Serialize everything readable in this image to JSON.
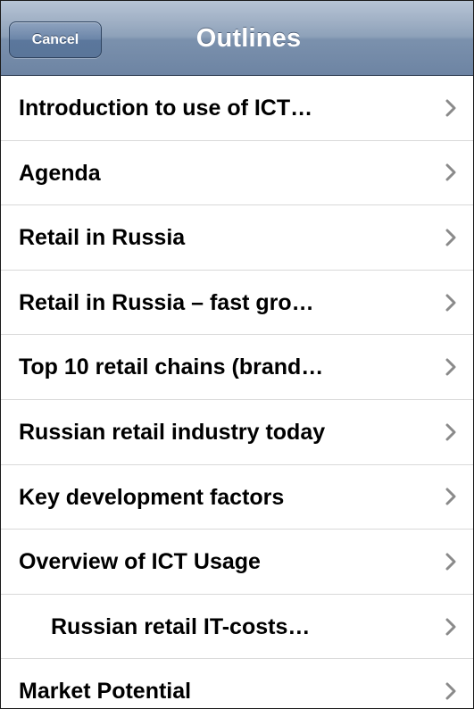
{
  "navbar": {
    "title": "Outlines",
    "cancel_label": "Cancel"
  },
  "outline": {
    "items": [
      {
        "label": "Introduction to use of ICT…",
        "indent": false,
        "icon": "chevron-right-icon"
      },
      {
        "label": "Agenda",
        "indent": false,
        "icon": "chevron-right-icon"
      },
      {
        "label": "Retail in Russia",
        "indent": false,
        "icon": "chevron-right-icon"
      },
      {
        "label": "Retail in Russia – fast gro…",
        "indent": false,
        "icon": "chevron-right-icon"
      },
      {
        "label": "Top 10 retail chains (brand…",
        "indent": false,
        "icon": "chevron-right-icon"
      },
      {
        "label": "Russian retail industry today",
        "indent": false,
        "icon": "chevron-right-icon"
      },
      {
        "label": "Key development factors",
        "indent": false,
        "icon": "chevron-right-icon"
      },
      {
        "label": "Overview of ICT Usage",
        "indent": false,
        "icon": "chevron-right-icon"
      },
      {
        "label": "Russian retail IT-costs…",
        "indent": true,
        "icon": "chevron-right-icon"
      },
      {
        "label": "Market Potential",
        "indent": false,
        "icon": "chevron-right-icon"
      }
    ]
  },
  "colors": {
    "navbar_top": "#b7c4d5",
    "navbar_bottom": "#6d84a3",
    "chevron": "#8a8a8a",
    "separator": "#d9d9d9"
  }
}
